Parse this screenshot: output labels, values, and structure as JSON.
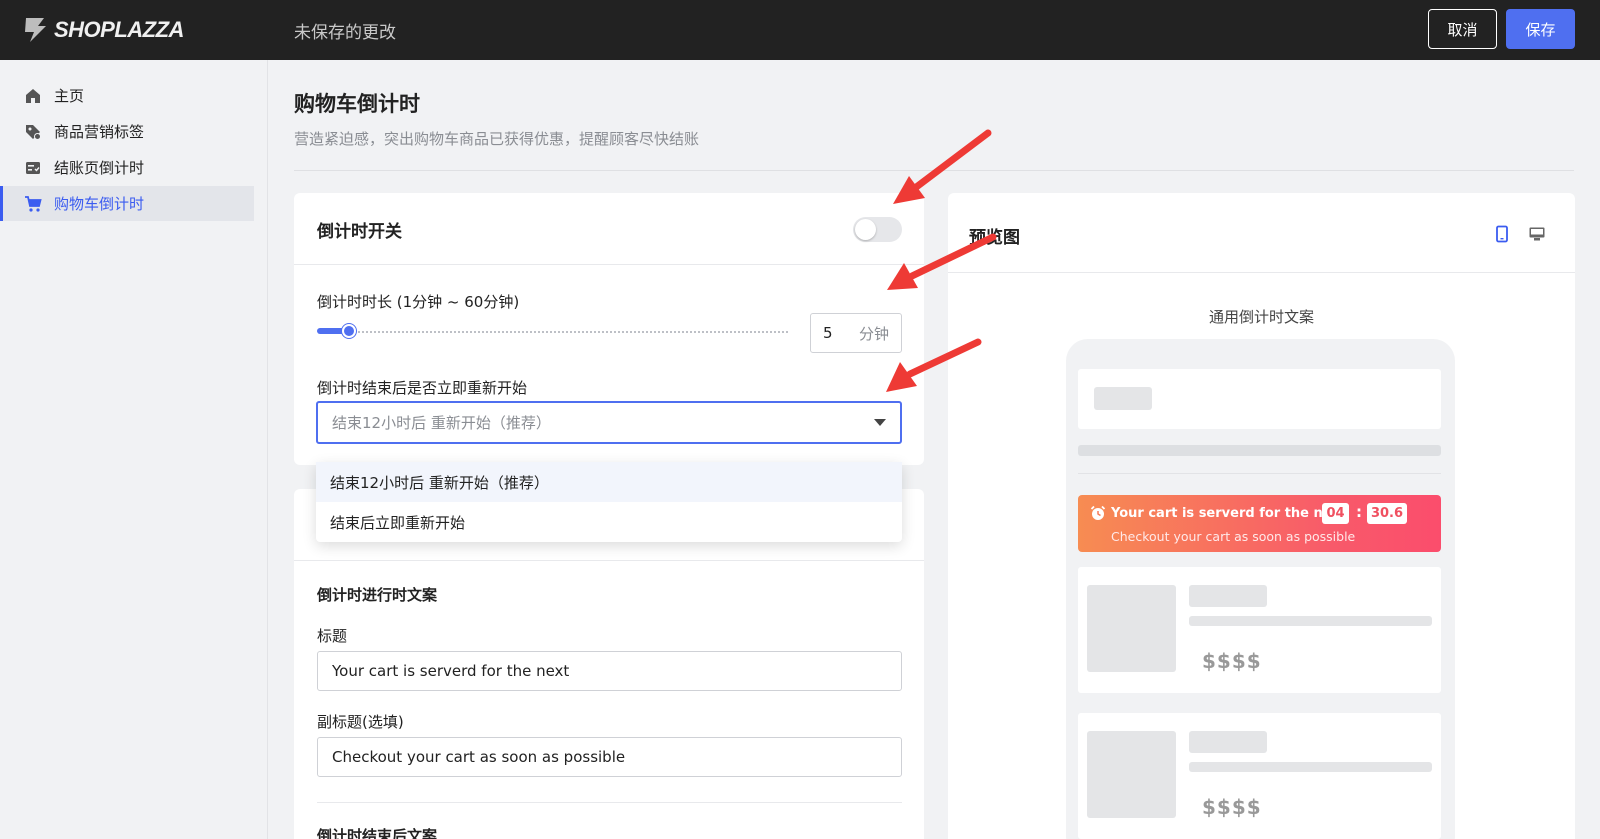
{
  "topbar": {
    "logo_text": "SHOPLAZZA",
    "status_text": "未保存的更改",
    "cancel_label": "取消",
    "save_label": "保存",
    "save_color": "#4f6ff0"
  },
  "sidebar": {
    "items": [
      {
        "label": "主页",
        "icon": "home-icon"
      },
      {
        "label": "商品营销标签",
        "icon": "tag-icon"
      },
      {
        "label": "结账页倒计时",
        "icon": "checkout-icon"
      },
      {
        "label": "购物车倒计时",
        "icon": "cart-icon",
        "active": true
      }
    ]
  },
  "page": {
    "title": "购物车倒计时",
    "description": "营造紧迫感，突出购物车商品已获得优惠，提醒顾客尽快结账"
  },
  "switch_card": {
    "title": "倒计时开关",
    "enabled": false,
    "duration_label": "倒计时时长 (1分钟 ~ 60分钟)",
    "duration_value": "5",
    "duration_unit": "分钟",
    "slider_min": 1,
    "slider_max": 60,
    "restart_label": "倒计时结束后是否立即重新开始",
    "restart_selected": "结束12小时后 重新开始（推荐）",
    "restart_options": [
      "结束12小时后 重新开始（推荐）",
      "结束后立即重新开始"
    ]
  },
  "copy_card": {
    "running_section": "倒计时进行时文案",
    "title_label": "标题",
    "title_value": "Your cart is serverd for the next",
    "subtitle_label": "副标题(选填)",
    "subtitle_value": "Checkout your cart as soon as possible",
    "ended_section": "倒计时结束后文案"
  },
  "preview": {
    "title": "预览图",
    "subtitle": "通用倒计时文案",
    "banner_title": "Your cart is serverd for the next",
    "banner_subtitle": "Checkout your cart as soon as possible",
    "minutes": "04",
    "seconds": "30.6",
    "price_1": "$$$$",
    "price_2": "$$$$"
  },
  "colors": {
    "accent": "#4f6ff0",
    "banner_start": "#f78c52",
    "banner_end": "#fb4d6c",
    "arrow": "#ee3a35"
  }
}
